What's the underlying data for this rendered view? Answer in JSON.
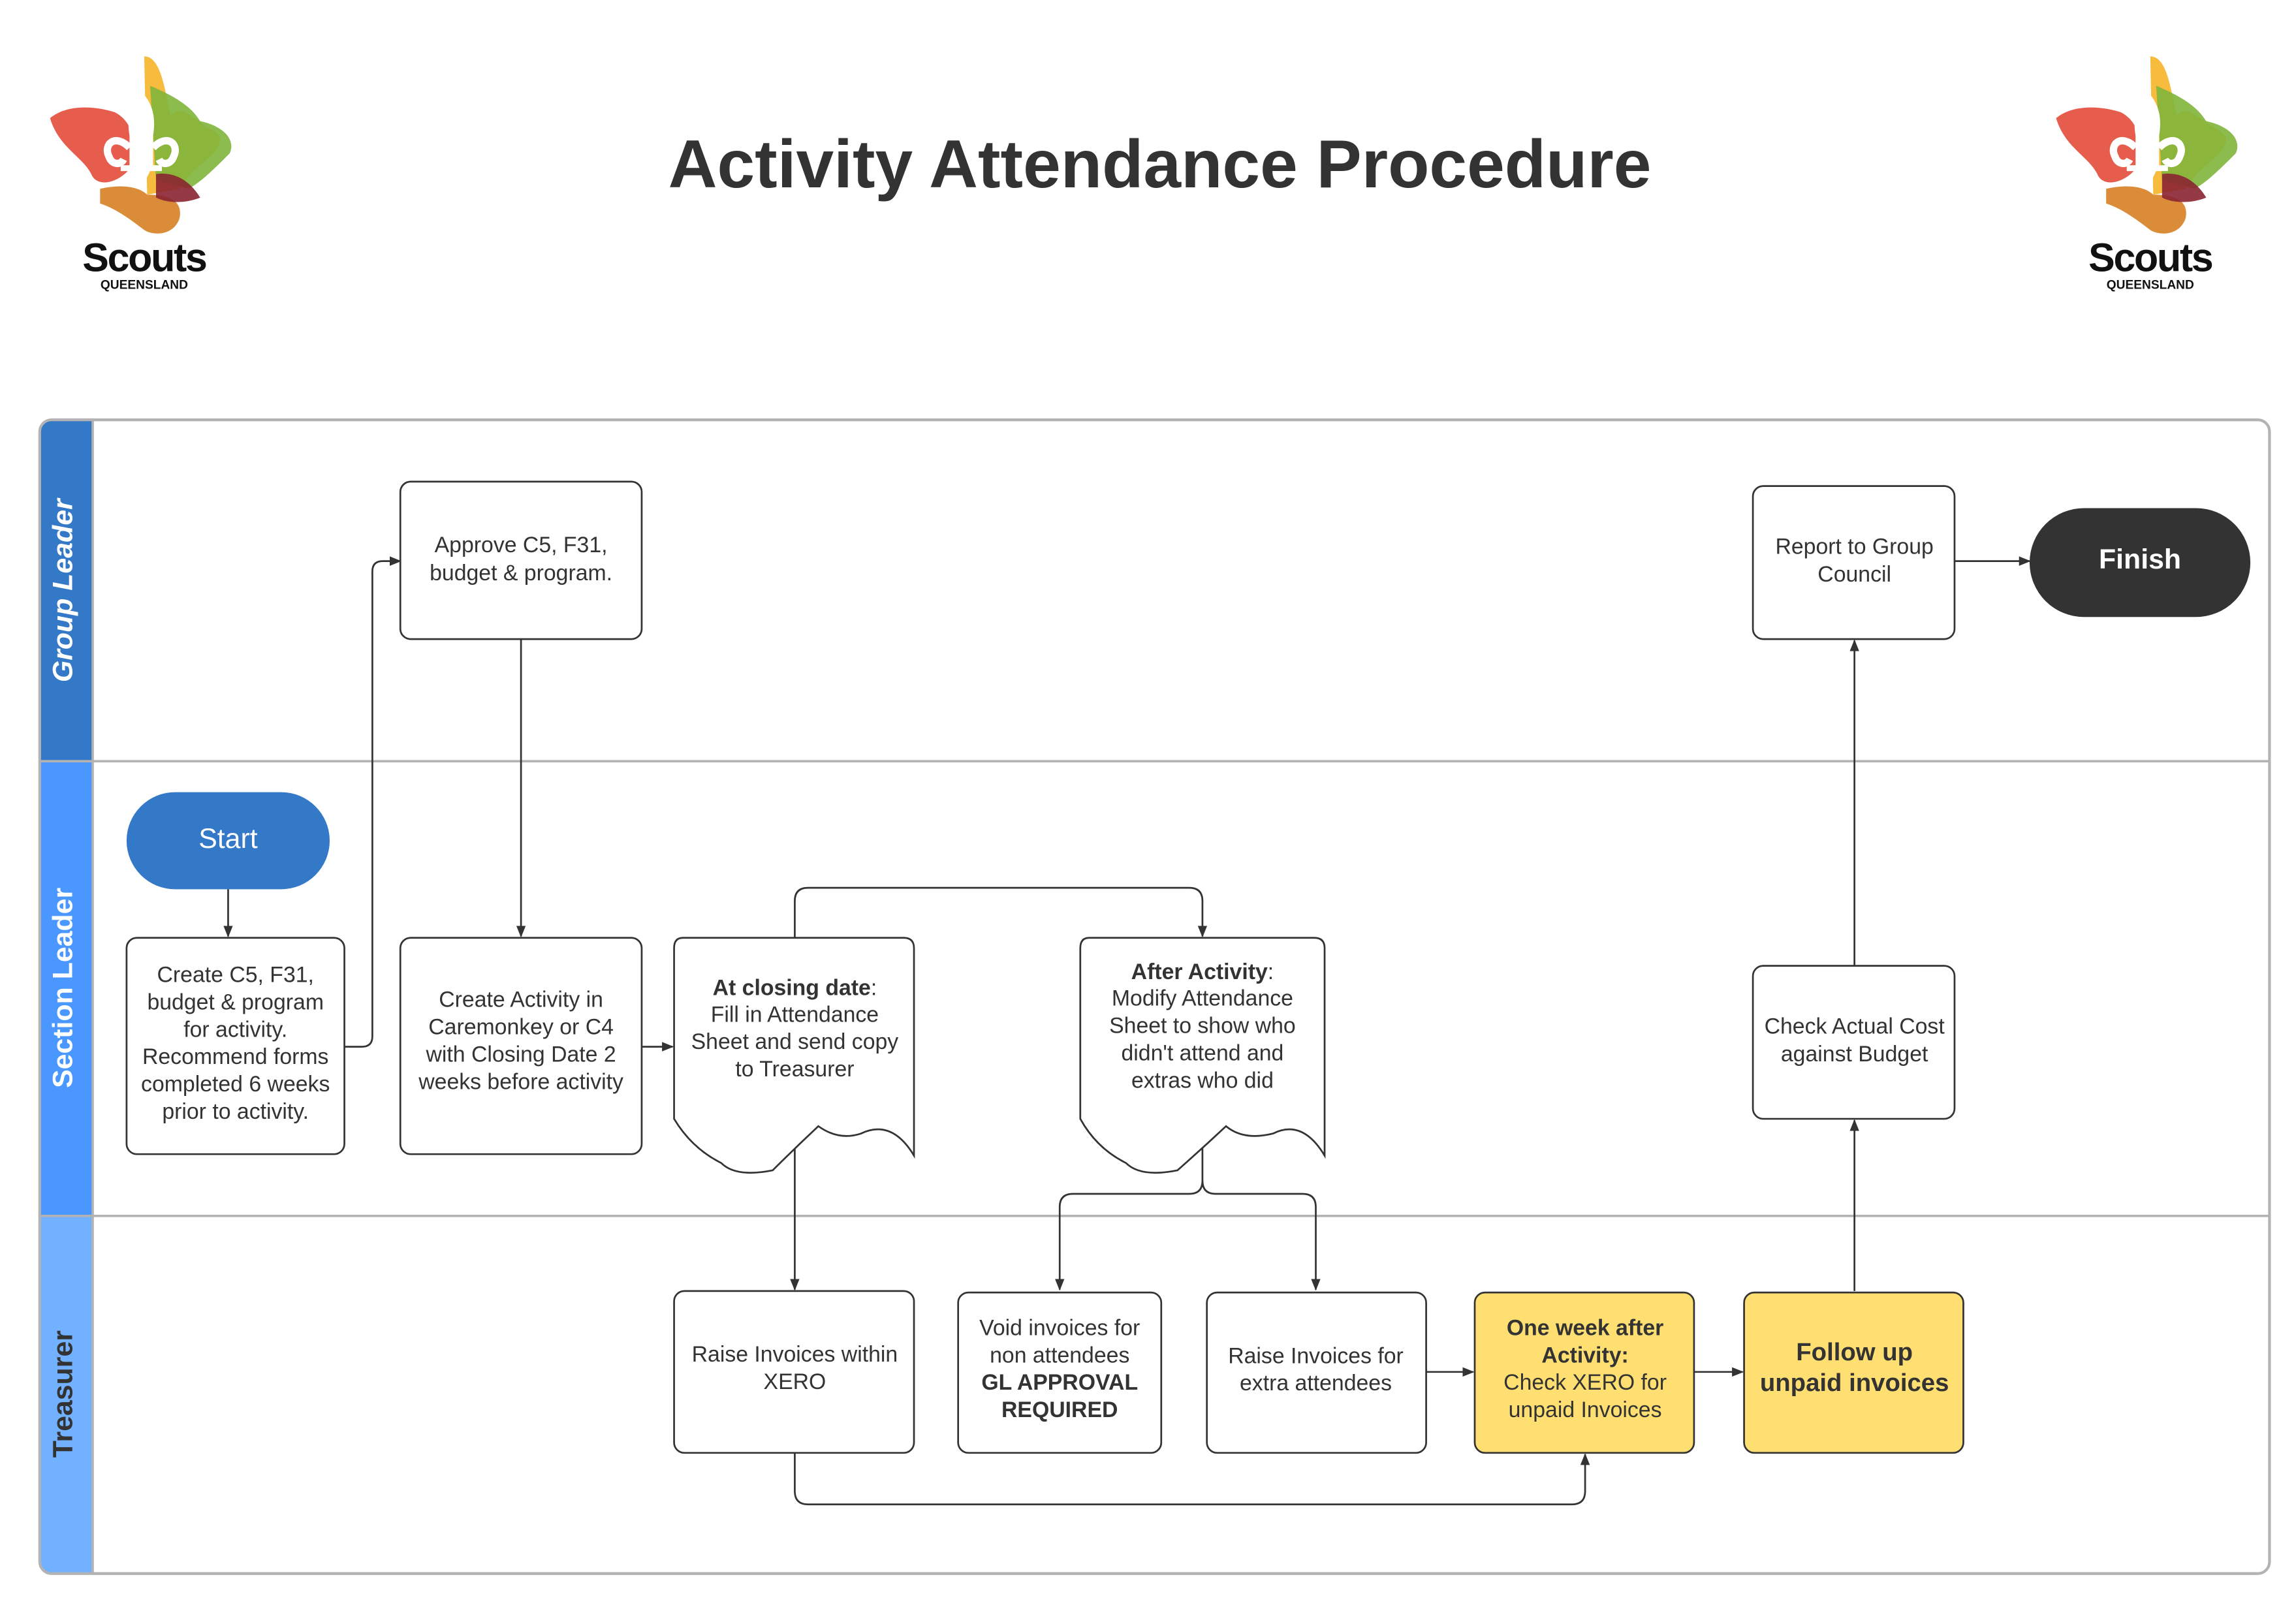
{
  "title": "Activity Attendance Procedure",
  "logo": {
    "word": "Scouts",
    "sub": "QUEENSLAND"
  },
  "lanes": [
    {
      "label": "Group Leader",
      "color": "#3478c8"
    },
    {
      "label": "Section Leader",
      "color": "#4a98ff"
    },
    {
      "label": "Treasurer",
      "color": "#72b1ff"
    }
  ],
  "colors": {
    "highlight": "#ffdf71",
    "terminal_start": "#3478c8",
    "terminal_finish": "#333333",
    "stroke": "#333333"
  },
  "nodes": {
    "start": {
      "label": "Start"
    },
    "finish": {
      "label": "Finish"
    },
    "create_forms": {
      "lines": [
        "Create C5, F31,",
        "budget & program",
        "for activity.",
        "Recommend forms",
        "completed 6 weeks",
        "prior to activity."
      ]
    },
    "approve": {
      "lines": [
        "Approve C5, F31,",
        "budget & program."
      ]
    },
    "create_activity": {
      "lines": [
        "Create Activity in",
        "Caremonkey or C4",
        "with Closing Date 2",
        "weeks before activity"
      ]
    },
    "closing_date": {
      "bold": "At closing date",
      "bold_suffix": ":",
      "lines": [
        "Fill in Attendance",
        "Sheet and send copy",
        "to Treasurer"
      ]
    },
    "after_activity": {
      "bold": "After Activity",
      "bold_suffix": ":",
      "lines": [
        "Modify Attendance",
        "Sheet to show who",
        "didn't attend and",
        "extras who did"
      ]
    },
    "report": {
      "lines": [
        "Report to Group",
        "Council"
      ]
    },
    "check_cost": {
      "lines": [
        "Check Actual Cost",
        "against Budget"
      ]
    },
    "raise_xero": {
      "lines": [
        "Raise Invoices within",
        "XERO"
      ]
    },
    "void": {
      "lines": [
        "Void invoices for",
        "non attendees"
      ],
      "bold_lines": [
        "GL APPROVAL",
        "REQUIRED"
      ]
    },
    "raise_extra": {
      "lines": [
        "Raise Invoices for",
        "extra attendees"
      ]
    },
    "one_week": {
      "bold_lines": [
        "One week after",
        "Activity:"
      ],
      "lines": [
        "Check XERO for",
        "unpaid Invoices"
      ]
    },
    "follow_up": {
      "bold_lines": [
        "Follow up",
        "unpaid invoices"
      ]
    }
  }
}
